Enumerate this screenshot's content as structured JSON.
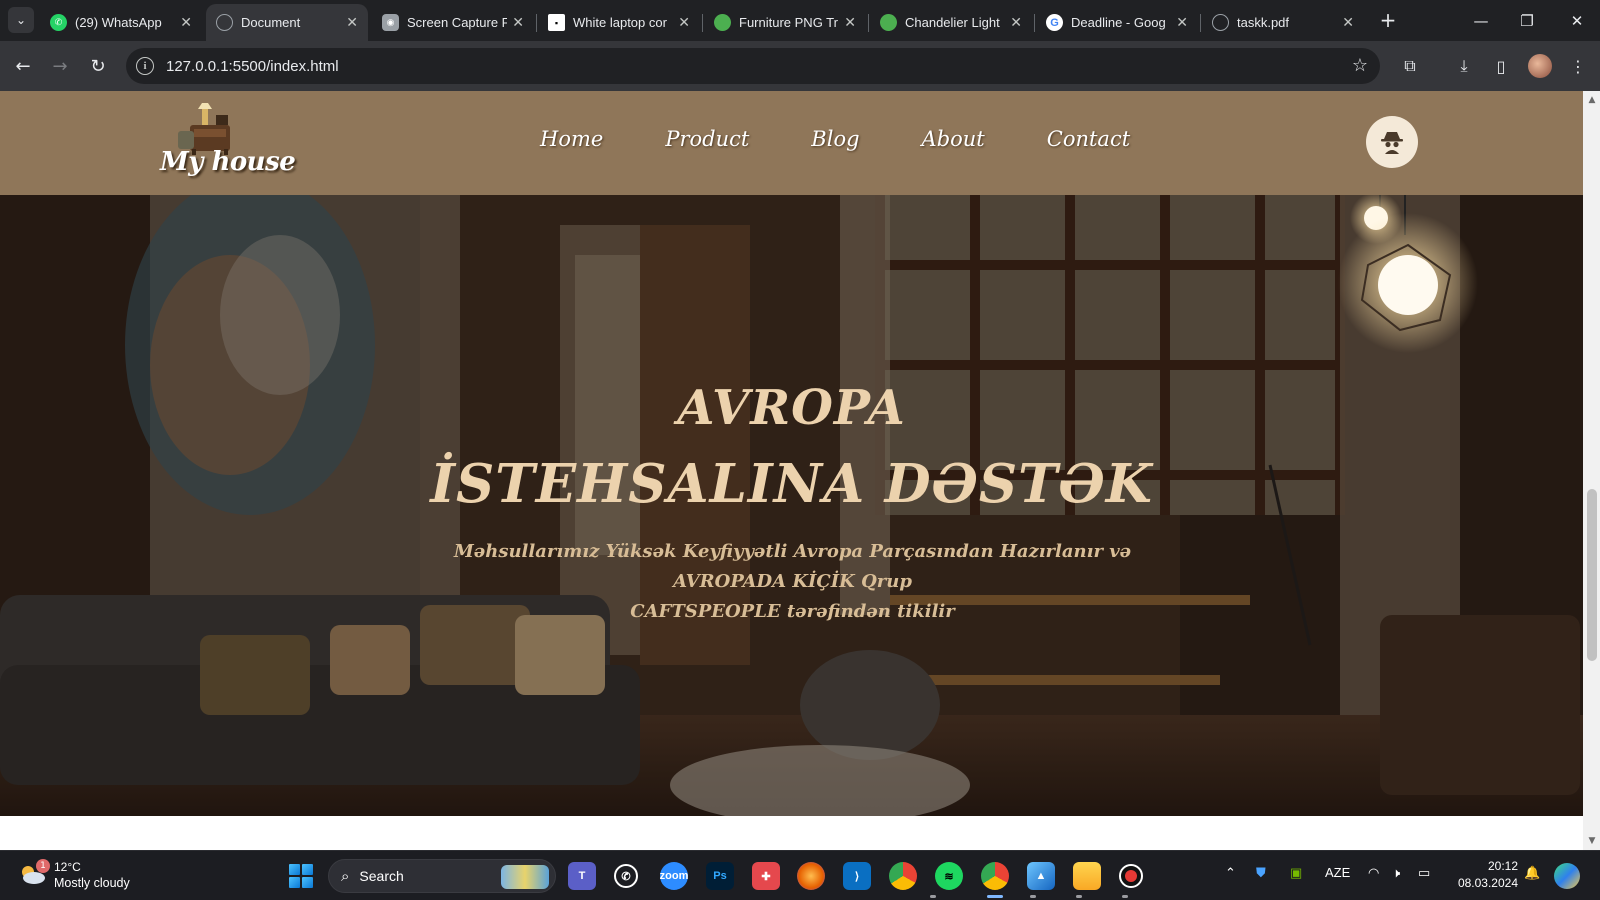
{
  "browser": {
    "tabs": [
      {
        "label": "(29) WhatsApp",
        "icon": "whatsapp-icon",
        "color": "#25d366",
        "active": false
      },
      {
        "label": "Document",
        "icon": "globe-icon",
        "color": "#9aa0a6",
        "active": true
      },
      {
        "label": "Screen Capture F",
        "icon": "camera-icon",
        "color": "#9aa0a6",
        "active": false
      },
      {
        "label": "White laptop cor",
        "icon": "unsplash-icon",
        "color": "#ffffff",
        "active": false
      },
      {
        "label": "Furniture PNG Tr",
        "icon": "pngtree-icon",
        "color": "#4caf50",
        "active": false
      },
      {
        "label": "Chandelier Light",
        "icon": "pngtree-icon",
        "color": "#4caf50",
        "active": false
      },
      {
        "label": "Deadline - Goog",
        "icon": "google-icon",
        "color": "#4285f4",
        "active": false
      },
      {
        "label": "taskk.pdf",
        "icon": "globe-icon",
        "color": "#9aa0a6",
        "active": false
      }
    ],
    "url": "127.0.0.1:5500/index.html"
  },
  "site": {
    "logo_text": "My house",
    "nav": [
      "Home",
      "Product",
      "Blog",
      "About",
      "Contact"
    ],
    "hero": {
      "title_line1": "AVROPA",
      "title_line2": "İSTEHSALINA DƏSTƏK",
      "subtitle_line1": "Məhsullarımız Yüksək Keyfiyyətli Avropa Parçasından Hazırlanır və AVROPADA KİÇİK Qrup",
      "subtitle_line2": "CAFTSPEOPLE tərəfindən tikilir"
    },
    "colors": {
      "header_bg": "#8f7659",
      "hero_text": "#ecd2ad",
      "hero_sub": "#d8bd96"
    }
  },
  "taskbar": {
    "weather_temp": "12°C",
    "weather_desc": "Mostly cloudy",
    "weather_badge": "1",
    "search_label": "Search",
    "apps": [
      "teams-icon",
      "whatsapp-icon",
      "zoom-icon",
      "photoshop-icon",
      "app-icon",
      "firefox-icon",
      "vscode-icon",
      "chrome-icon",
      "spotify-icon",
      "chrome-profile-icon",
      "photos-icon",
      "file-explorer-icon",
      "recorder-icon"
    ],
    "language": "AZE",
    "time": "20:12",
    "date": "08.03.2024"
  }
}
